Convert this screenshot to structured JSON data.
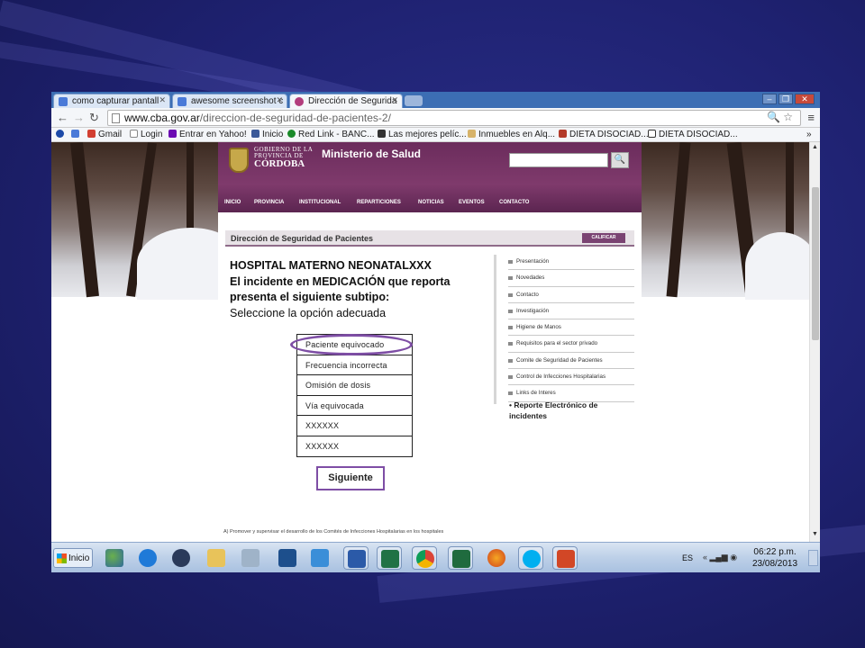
{
  "browser": {
    "tabs": [
      {
        "label": "como capturar pantall",
        "icon": "google-icon"
      },
      {
        "label": "awesome screenshot c",
        "icon": "google-icon"
      },
      {
        "label": "Dirección de Segurida",
        "icon": "cba-icon"
      }
    ],
    "url_domain": "www.cba.gov.ar",
    "url_path": "/direccion-de-seguridad-de-pacientes-2/",
    "bookmarks": [
      {
        "label": "",
        "icon": "blue-dot-icon"
      },
      {
        "label": "",
        "icon": "google-icon"
      },
      {
        "label": "Gmail",
        "icon": "gmail-icon"
      },
      {
        "label": "Login",
        "icon": "page-icon"
      },
      {
        "label": "Entrar en Yahoo!",
        "icon": "yahoo-icon"
      },
      {
        "label": "Inicio",
        "icon": "facebook-icon"
      },
      {
        "label": "Red Link - BANC...",
        "icon": "redlink-icon"
      },
      {
        "label": "Las mejores pelíc...",
        "icon": "people-icon"
      },
      {
        "label": "Inmuebles en Alq...",
        "icon": "house-icon"
      },
      {
        "label": "DIETA DISOCIAD...",
        "icon": "diet-icon"
      },
      {
        "label": "DIETA DISOCIAD...",
        "icon": "monitor-icon"
      }
    ],
    "bookmarks_more": "»"
  },
  "site": {
    "gov_line1": "GOBIERNO DE LA",
    "gov_line2": "PROVINCIA DE",
    "gov_line3": "CÓRDOBA",
    "ministry": "Ministerio de Salud",
    "nav": [
      "INICIO",
      "PROVINCIA",
      "INSTITUCIONAL",
      "REPARTICIONES",
      "NOTICIAS",
      "EVENTOS",
      "CONTACTO"
    ],
    "section_title": "Dirección de Seguridad de Pacientes",
    "calificar": "CALIFICAR",
    "side_links": [
      "Presentación",
      "Novedades",
      "Contacto",
      "Investigación",
      "Higiene de Manos",
      "Requisitos para el sector privado",
      "Comite de Seguridad de Pacientes",
      "Control de Infecciones Hospitalarias",
      "Links de Interes"
    ],
    "footer_text": "A) Promover y supervisar el desarrollo de los Comités de Infecciones Hospitalarias en los hospitales"
  },
  "slide": {
    "line1": "HOSPITAL MATERNO NEONATALXXX",
    "line2": "El incidente en MEDICACIÓN que reporta",
    "line3": "presenta el siguiente subtipo:",
    "line4": "Seleccione la opción adecuada",
    "options": [
      "Paciente equivocado",
      "Frecuencia incorrecta",
      "Omisión de dosis",
      "Vía equivocada",
      "XXXXXX",
      "XXXXXX"
    ],
    "next_button": "Siguiente",
    "report_link": "• Reporte Electrónico de incidentes"
  },
  "taskbar": {
    "start_label": "Inicio",
    "lang": "ES",
    "time": "06:22 p.m.",
    "date": "23/08/2013"
  },
  "colors": {
    "slide_bg": "#1e2170",
    "accent_purple": "#7e4ea5",
    "header_purple": "#6b2c5c"
  }
}
